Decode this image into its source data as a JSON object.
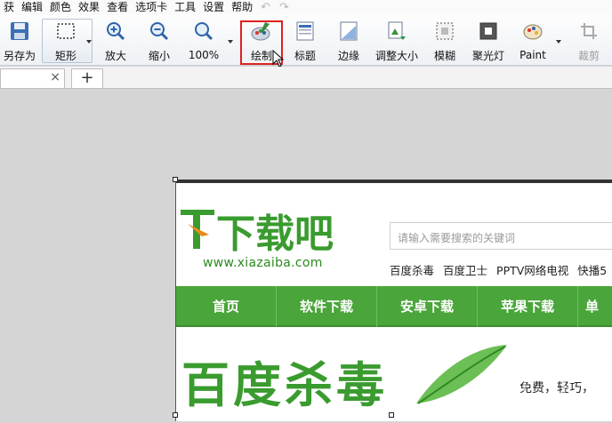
{
  "menu": {
    "items": [
      "获",
      "编辑",
      "颜色",
      "效果",
      "查看",
      "选项卡",
      "工具",
      "设置",
      "帮助"
    ],
    "undo_icon": "undo-icon",
    "redo_icon": "redo-icon"
  },
  "toolbar": {
    "save_as": "另存为",
    "rectangle": "矩形",
    "zoom_in": "放大",
    "zoom_out": "缩小",
    "zoom_level": "100%",
    "draw": "绘制",
    "title": "标题",
    "edge": "边缘",
    "resize": "调整大小",
    "blur": "模糊",
    "spotlight": "聚光灯",
    "paint": "Paint",
    "crop": "裁剪"
  },
  "tabs": {
    "close_symbol": "×",
    "new_tab_symbol": "+"
  },
  "webpage": {
    "logo_text": "下载吧",
    "logo_url": "www.xiazaiba.com",
    "search_placeholder": "请输入需要搜索的关键词",
    "hot_links": [
      "百度杀毒",
      "百度卫士",
      "PPTV网络电视",
      "快播5"
    ],
    "nav": [
      "首页",
      "软件下载",
      "安卓下载",
      "苹果下载",
      "单"
    ],
    "banner_title": "百度杀毒",
    "banner_slogan": "免费，轻巧，"
  },
  "colors": {
    "accent_green": "#4aa53a",
    "highlight_red": "#e02020"
  }
}
